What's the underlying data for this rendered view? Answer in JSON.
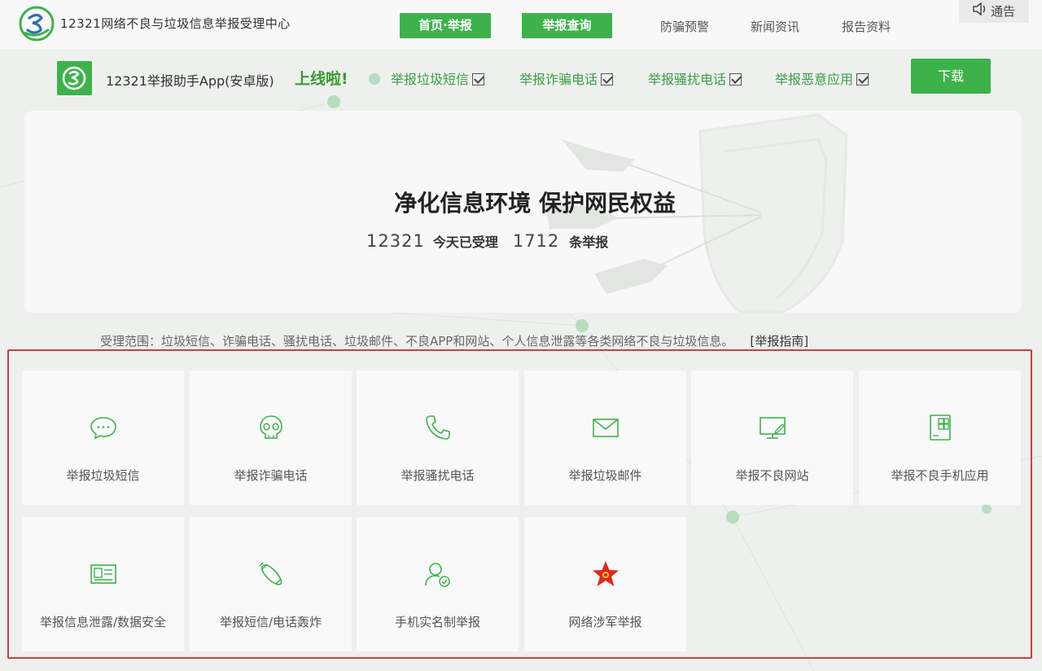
{
  "header": {
    "site_title": "12321网络不良与垃圾信息举报受理中心",
    "nav_home": "首页·举报",
    "nav_query": "举报查询",
    "nav_links": [
      "防骗预警",
      "新闻资讯",
      "报告资料"
    ],
    "notice_label": "通告",
    "logo_icon": "12321-logo-icon"
  },
  "promo": {
    "app_label": "12321举报助手App(安卓版)",
    "online_label": "上线啦!",
    "items": [
      "举报垃圾短信",
      "举报诈骗电话",
      "举报骚扰电话",
      "举报恶意应用"
    ],
    "download_label": "下载"
  },
  "hero": {
    "title": "净化信息环境 保护网民权益",
    "hotline": "12321",
    "today_label": "今天已受理",
    "count": "1712",
    "count_suffix": "条举报"
  },
  "scope": {
    "text": "受理范围：垃圾短信、诈骗电话、骚扰电话、垃圾邮件、不良APP和网站、个人信息泄露等各类网络不良与垃圾信息。",
    "guide_link": "[举报指南]"
  },
  "tiles": [
    {
      "label": "举报垃圾短信",
      "icon": "chat-bubble-icon"
    },
    {
      "label": "举报诈骗电话",
      "icon": "skull-icon"
    },
    {
      "label": "举报骚扰电话",
      "icon": "phone-icon"
    },
    {
      "label": "举报垃圾邮件",
      "icon": "envelope-icon"
    },
    {
      "label": "举报不良网站",
      "icon": "monitor-icon"
    },
    {
      "label": "举报不良手机应用",
      "icon": "mobile-app-icon"
    },
    {
      "label": "举报信息泄露/数据安全",
      "icon": "id-card-icon"
    },
    {
      "label": "举报短信/电话轰炸",
      "icon": "bomb-icon"
    },
    {
      "label": "手机实名制举报",
      "icon": "user-check-icon"
    },
    {
      "label": "网络涉军举报",
      "icon": "red-star-icon"
    }
  ],
  "colors": {
    "brand_green": "#3db24b",
    "highlight_red": "#d33c3c",
    "star_red": "#e3261b",
    "star_gold": "#f2c230"
  }
}
